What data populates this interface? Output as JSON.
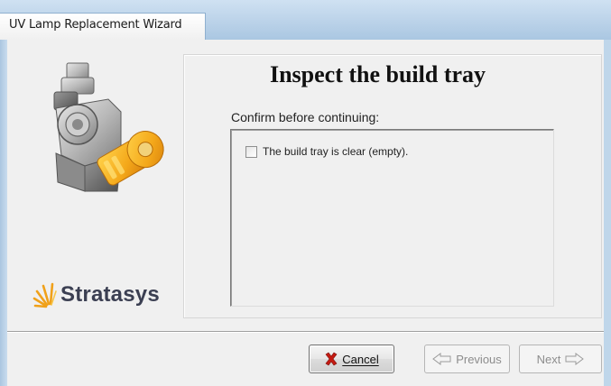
{
  "window": {
    "title": "UV Lamp Replacement Wizard"
  },
  "page": {
    "heading": "Inspect the build tray",
    "prompt": "Confirm before continuing:",
    "checkbox_label": "The build tray is clear (empty).",
    "checkbox_checked": false
  },
  "brand": {
    "logo_text": "Stratasys",
    "accent_color": "#f0a11a"
  },
  "buttons": {
    "cancel_label": "Cancel",
    "previous_label": "Previous",
    "next_label": "Next",
    "previous_enabled": false,
    "next_enabled": false
  },
  "icons": {
    "cancel": "red-x-icon",
    "previous": "previous-arrow-icon",
    "next": "next-arrow-icon",
    "illustration": "uv-lamp-key-illustration"
  }
}
